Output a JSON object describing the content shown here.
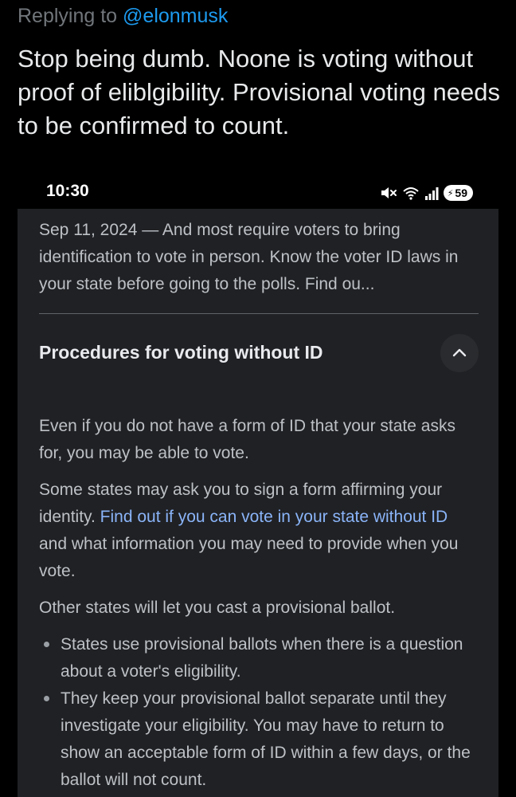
{
  "reply": {
    "prefix": "Replying to",
    "handle": "@elonmusk"
  },
  "tweet": {
    "text": "Stop being dumb. Noone is voting without proof of eliblgibility. Provisional voting needs to be confirmed to count."
  },
  "phone": {
    "time": "10:30",
    "status_icons": [
      "mute-icon",
      "wifi-icon",
      "signal-icon"
    ],
    "battery_level": "59"
  },
  "search_result": {
    "snippet": "Sep 11, 2024 — And most require voters to bring identification to vote in person. Know the voter ID laws in your state before going to the polls. Find ou...",
    "accordion": {
      "title": "Procedures for voting without ID",
      "expanded": true,
      "paragraph_1": "Even if you do not have a form of ID that your state asks for, you may be able to vote.",
      "paragraph_2_before": "Some states may ask you to sign a form affirming your identity. ",
      "paragraph_2_link": "Find out if you can vote in your state without ID",
      "paragraph_2_after": " and what information you may need to provide when you vote.",
      "paragraph_3": "Other states will let you cast a provisional ballot.",
      "bullets": [
        "States use provisional ballots when there is a question about a voter's eligibility.",
        "They keep your provisional ballot separate until they investigate your eligibility. You may have to return to show an acceptable form of ID within a few days, or the ballot will not count."
      ]
    }
  },
  "colors": {
    "background": "#000000",
    "card_background": "#202124",
    "link": "#8ab4f8",
    "handle": "#1d9bf0"
  }
}
